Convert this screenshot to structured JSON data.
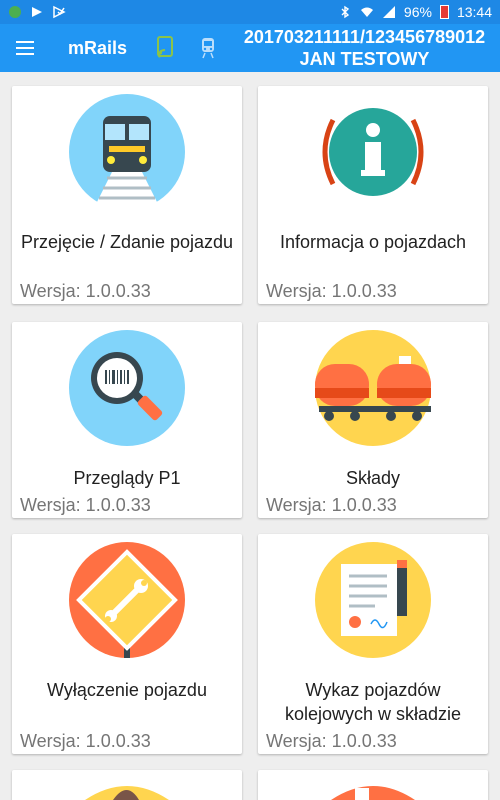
{
  "status_bar": {
    "battery_percent": "96%",
    "time": "13:44"
  },
  "app_bar": {
    "title": "mRails",
    "user_id": "201703211111/123456789012",
    "user_name": "JAN TESTOWY"
  },
  "tiles": [
    {
      "label": "Przejęcie / Zdanie pojazdu",
      "version": "Wersja: 1.0.0.33",
      "icon": "train-icon"
    },
    {
      "label": "Informacja o pojazdach",
      "version": "Wersja: 1.0.0.33",
      "icon": "info-icon"
    },
    {
      "label": "Przeglądy P1",
      "version": "Wersja: 1.0.0.33",
      "icon": "barcode-magnifier-icon"
    },
    {
      "label": "Składy",
      "version": "Wersja: 1.0.0.33",
      "icon": "tank-wagon-icon"
    },
    {
      "label": "Wyłączenie pojazdu",
      "version": "Wersja: 1.0.0.33",
      "icon": "wrench-sign-icon"
    },
    {
      "label": "Wykaz pojazdów kolejowych w składzie",
      "version": "Wersja: 1.0.0.33",
      "icon": "document-pen-icon"
    }
  ],
  "colors": {
    "status_bar": "#1e88e5",
    "app_bar": "#2196f3",
    "icon_blue": "#81d4fa",
    "icon_yellow": "#ffd54f",
    "icon_red": "#ff7043",
    "info_green": "#26a69a"
  }
}
